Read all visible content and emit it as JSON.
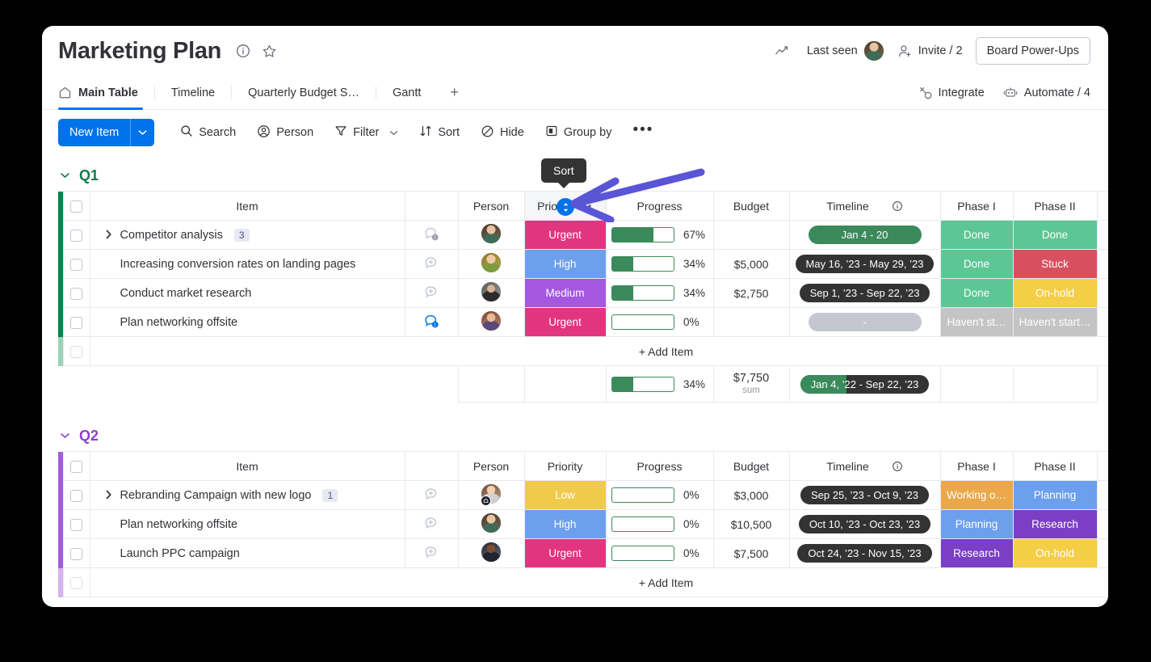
{
  "header": {
    "title": "Marketing Plan",
    "info_icon": "info-icon",
    "favorite_icon": "star-icon",
    "activity_icon": "activity-graph-icon",
    "last_seen_label": "Last seen",
    "invite_label": "Invite / 2",
    "power_ups_label": "Board Power-Ups",
    "integrate_label": "Integrate",
    "automate_label": "Automate / 4"
  },
  "tabs": [
    {
      "label": "Main Table",
      "active": true,
      "icon": "home-icon"
    },
    {
      "label": "Timeline",
      "active": false
    },
    {
      "label": "Quarterly Budget S…",
      "active": false
    },
    {
      "label": "Gantt",
      "active": false
    },
    {
      "label": "+",
      "active": false
    }
  ],
  "toolbar": {
    "new_item_label": "New Item",
    "new_item_caret": "chevron-down-icon",
    "search_label": "Search",
    "person_label": "Person",
    "filter_label": "Filter",
    "sort_label": "Sort",
    "hide_label": "Hide",
    "group_by_label": "Group by",
    "more_label": "•••"
  },
  "tooltip": {
    "label": "Sort",
    "badge_icon": "sort-updown-icon"
  },
  "columns": [
    "Item",
    "Person",
    "Priority",
    "Progress",
    "Budget",
    "Timeline",
    "Phase I",
    "Phase II"
  ],
  "groups": [
    {
      "name": "Q1",
      "color": "#00854d",
      "title_color": "#0f7a4a",
      "priority_header_active": true,
      "rows": [
        {
          "item": "Competitor analysis",
          "subitems": "3",
          "expandable": true,
          "chat": {
            "state": "unread-gray",
            "count": "1"
          },
          "avatar_class": "av1",
          "priority": {
            "label": "Urgent",
            "color": "#e2445c_pink"
          },
          "progress": 67,
          "progress_label": "67%",
          "budget": "",
          "timeline": {
            "label": "Jan 4 - 20",
            "style": "green"
          },
          "phase1": {
            "label": "Done",
            "color": "#5dc695"
          },
          "phase2": {
            "label": "Done",
            "color": "#5dc695"
          }
        },
        {
          "item": "Increasing conversion rates on landing pages",
          "subitems": "",
          "expandable": false,
          "chat": {
            "state": "add",
            "count": ""
          },
          "avatar_class": "av2",
          "priority": {
            "label": "High",
            "color": "#6c9fec"
          },
          "progress": 34,
          "progress_label": "34%",
          "budget": "$5,000",
          "timeline": {
            "label": "May 16, ’23 - May 29, ’23",
            "style": "dark"
          },
          "phase1": {
            "label": "Done",
            "color": "#5dc695"
          },
          "phase2": {
            "label": "Stuck",
            "color": "#d6505f"
          }
        },
        {
          "item": "Conduct market research",
          "subitems": "",
          "expandable": false,
          "chat": {
            "state": "add",
            "count": ""
          },
          "avatar_class": "av3",
          "priority": {
            "label": "Medium",
            "color": "#a358df"
          },
          "progress": 34,
          "progress_label": "34%",
          "budget": "$2,750",
          "timeline": {
            "label": "Sep 1, ’23 - Sep 22, ’23",
            "style": "dark"
          },
          "phase1": {
            "label": "Done",
            "color": "#5dc695"
          },
          "phase2": {
            "label": "On-hold",
            "color": "#f5ce47"
          }
        },
        {
          "item": "Plan networking offsite",
          "subitems": "",
          "expandable": false,
          "chat": {
            "state": "unread-blue",
            "count": "1"
          },
          "avatar_class": "av4",
          "priority": {
            "label": "Urgent",
            "color": "#e2445c_pink"
          },
          "progress": 0,
          "progress_label": "0%",
          "budget": "",
          "timeline": {
            "label": "-",
            "style": "gray"
          },
          "phase1": {
            "label": "Haven't st…",
            "color": "#c4c4c4"
          },
          "phase2": {
            "label": "Haven't start…",
            "color": "#c4c4c4"
          }
        }
      ],
      "add_item_label": "+ Add Item",
      "summary": {
        "progress": 34,
        "progress_label": "34%",
        "budget_amount": "$7,750",
        "budget_sublabel": "sum",
        "timeline_label": "Jan 4, ’22 - Sep 22, ’23",
        "timeline_fill_pct": 36
      }
    },
    {
      "name": "Q2",
      "color": "#a25ddc",
      "title_color": "#8f3fd0",
      "priority_header_active": false,
      "rows": [
        {
          "item": "Rebranding Campaign with new logo",
          "subitems": "1",
          "expandable": true,
          "chat": {
            "state": "add",
            "count": ""
          },
          "avatar_class": "av5",
          "priority": {
            "label": "Low",
            "color": "#f0cb4b"
          },
          "progress": 0,
          "progress_label": "0%",
          "budget": "$3,000",
          "timeline": {
            "label": "Sep 25, ’23 - Oct 9, ’23",
            "style": "dark"
          },
          "phase1": {
            "label": "Working o…",
            "color": "#efa котор"
          },
          "phase2": {
            "label": "Planning",
            "color": "#6c9fec"
          }
        },
        {
          "item": "Plan networking offsite",
          "subitems": "",
          "expandable": false,
          "chat": {
            "state": "add",
            "count": ""
          },
          "avatar_class": "av1",
          "priority": {
            "label": "High",
            "color": "#6c9fec"
          },
          "progress": 0,
          "progress_label": "0%",
          "budget": "$10,500",
          "timeline": {
            "label": "Oct 10, ’23 - Oct 23, ’23",
            "style": "dark"
          },
          "phase1": {
            "label": "Planning",
            "color": "#6c9fec"
          },
          "phase2": {
            "label": "Research",
            "color": "#7a3fc4"
          }
        },
        {
          "item": "Launch PPC campaign",
          "subitems": "",
          "expandable": false,
          "chat": {
            "state": "add",
            "count": ""
          },
          "avatar_class": "av6",
          "priority": {
            "label": "Urgent",
            "color": "#e2445c_pink"
          },
          "progress": 0,
          "progress_label": "0%",
          "budget": "$7,500",
          "timeline": {
            "label": "Oct 24, ’23 - Nov 15, ’23",
            "style": "dark"
          },
          "phase1": {
            "label": "Research",
            "color": "#7a3fc4"
          },
          "phase2": {
            "label": "On-hold",
            "color": "#f5ce47"
          }
        }
      ],
      "add_item_label": "+ Add Item"
    }
  ],
  "palette": {
    "urgent": "#e2357f",
    "high": "#6c9fec",
    "medium": "#a358df",
    "low": "#f0cb4b",
    "done": "#5dc695",
    "stuck": "#d6505f",
    "onhold": "#f5ce47",
    "not_started": "#c4c4c4",
    "working_on_it": "#eaa84a",
    "planning": "#6c9fec",
    "research": "#7a3fc4",
    "accent_blue": "#0073ea",
    "arrow_purple": "#5a55d6"
  }
}
